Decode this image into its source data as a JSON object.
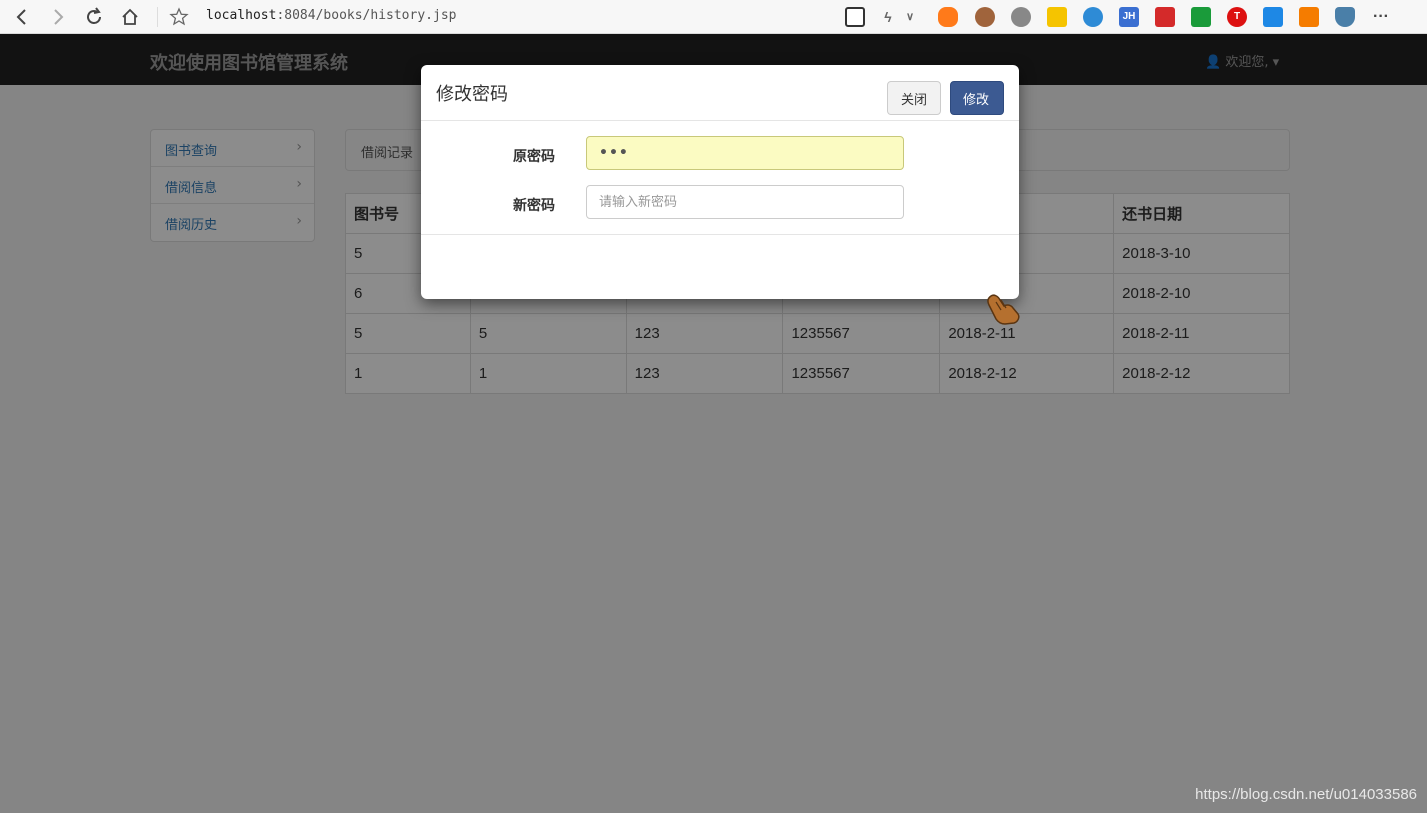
{
  "browser": {
    "url_host": "localhost",
    "url_rest": ":8084/books/history.jsp"
  },
  "navbar": {
    "brand": "欢迎使用图书馆管理系统",
    "user_menu": "欢迎您,"
  },
  "sidebar": {
    "items": [
      {
        "label": "图书查询"
      },
      {
        "label": "借阅信息"
      },
      {
        "label": "借阅历史"
      }
    ]
  },
  "breadcrumb": {
    "text": "借阅记录"
  },
  "table": {
    "header_first": "图书号",
    "header_last": "还书日期",
    "rows": [
      {
        "c1": "5",
        "c6": "2018-3-10"
      },
      {
        "c1": "6",
        "c6": "2018-2-10"
      },
      {
        "c1": "5",
        "c2": "5",
        "c3": "123",
        "c4": "1235567",
        "c5": "2018-2-11",
        "c6": "2018-2-11"
      },
      {
        "c1": "1",
        "c2": "1",
        "c3": "123",
        "c4": "1235567",
        "c5": "2018-2-12",
        "c6": "2018-2-12"
      }
    ]
  },
  "modal": {
    "title": "修改密码",
    "close_symbol": "×",
    "old_password_label": "原密码",
    "old_password_value": "•••",
    "new_password_label": "新密码",
    "new_password_placeholder": "请输入新密码",
    "close_button": "关闭",
    "submit_button": "修改"
  },
  "watermark": "https://blog.csdn.net/u014033586",
  "colors": {
    "primary": "#3c5a92",
    "navbar": "#222222",
    "autofill": "#fbfbc2"
  }
}
